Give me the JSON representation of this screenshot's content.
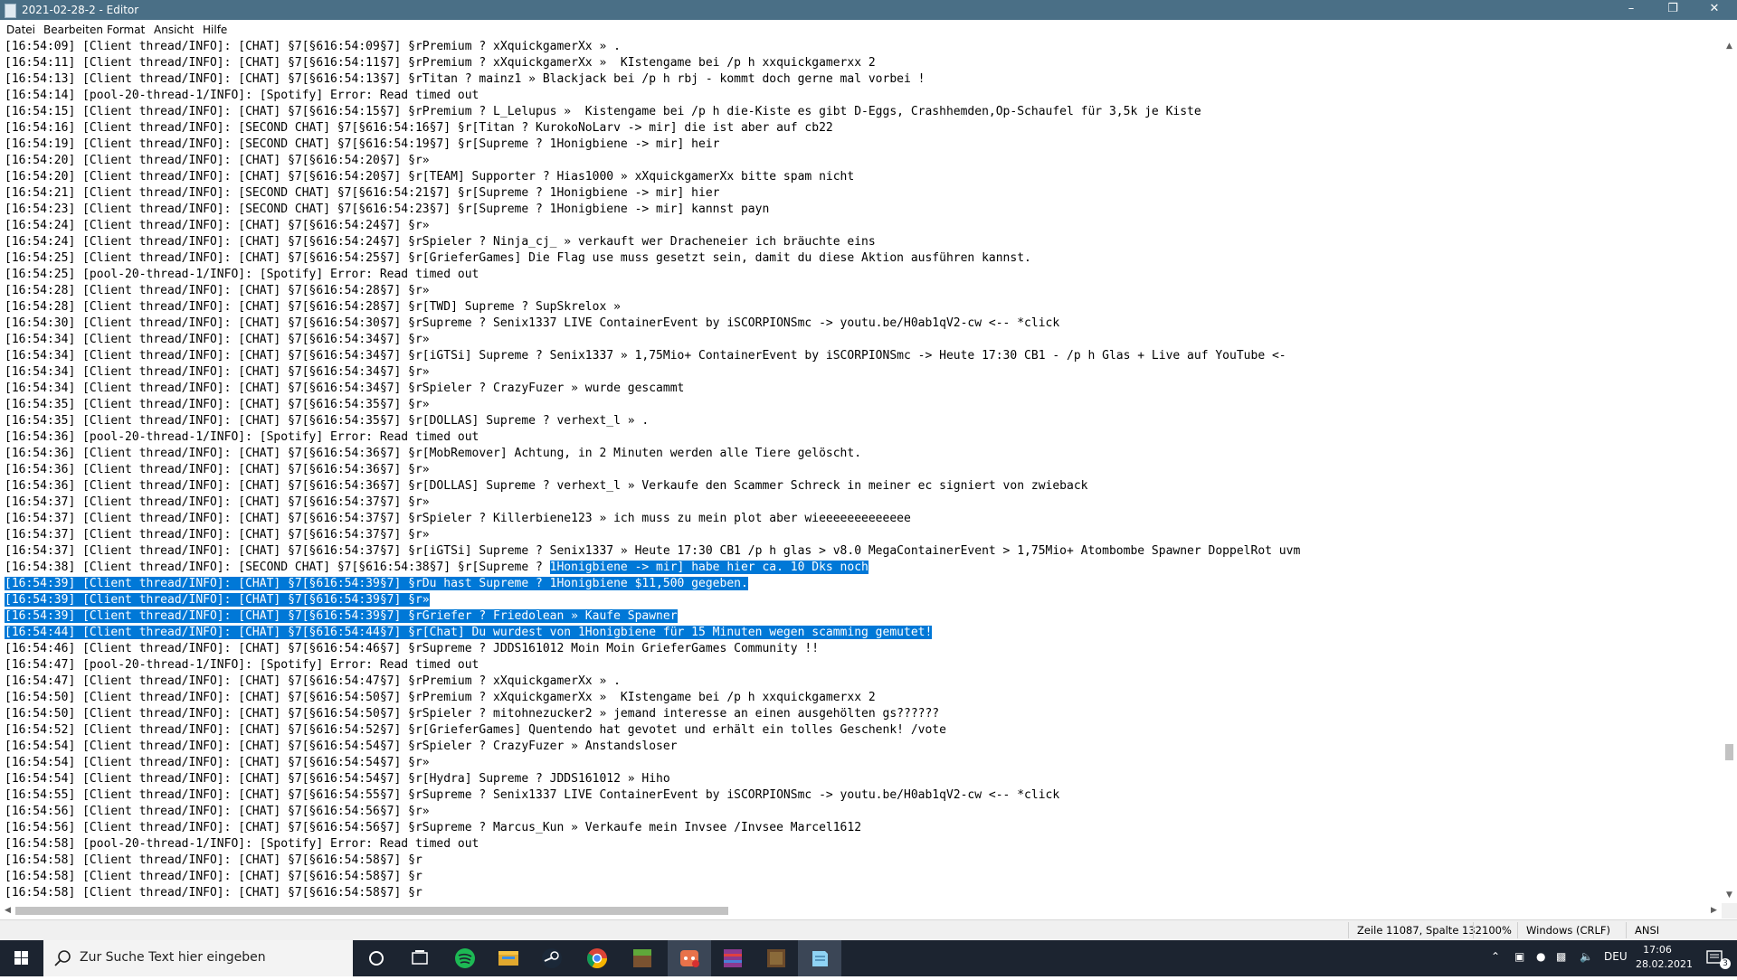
{
  "window": {
    "title": "2021-02-28-2 - Editor"
  },
  "menu": [
    "Datei",
    "Bearbeiten",
    "Format",
    "Ansicht",
    "Hilfe"
  ],
  "lines": [
    [
      "[16:54:09] [Client thread/INFO]: [CHAT] §7[§616:54:09§7] §rPremium ? xXquickgamerXx » .",
      ""
    ],
    [
      "[16:54:11] [Client thread/INFO]: [CHAT] §7[§616:54:11§7] §rPremium ? xXquickgamerXx »  KIstengame bei /p h xxquickgamerxx 2",
      ""
    ],
    [
      "[16:54:13] [Client thread/INFO]: [CHAT] §7[§616:54:13§7] §rTitan ? mainz1 » Blackjack bei /p h rbj - kommt doch gerne mal vorbei !",
      ""
    ],
    [
      "[16:54:14] [pool-20-thread-1/INFO]: [Spotify] Error: Read timed out",
      ""
    ],
    [
      "[16:54:15] [Client thread/INFO]: [CHAT] §7[§616:54:15§7] §rPremium ? L_Lelupus »  Kistengame bei /p h die-Kiste es gibt D-Eggs, Crashhemden,Op-Schaufel für 3,5k je Kiste",
      ""
    ],
    [
      "[16:54:16] [Client thread/INFO]: [SECOND CHAT] §7[§616:54:16§7] §r[Titan ? KurokoNoLarv -> mir] die ist aber auf cb22",
      ""
    ],
    [
      "[16:54:19] [Client thread/INFO]: [SECOND CHAT] §7[§616:54:19§7] §r[Supreme ? 1Honigbiene -> mir] heir",
      ""
    ],
    [
      "[16:54:20] [Client thread/INFO]: [CHAT] §7[§616:54:20§7] §r»",
      ""
    ],
    [
      "[16:54:20] [Client thread/INFO]: [CHAT] §7[§616:54:20§7] §r[TEAM] Supporter ? Hias1000 » xXquickgamerXx bitte spam nicht",
      ""
    ],
    [
      "[16:54:21] [Client thread/INFO]: [SECOND CHAT] §7[§616:54:21§7] §r[Supreme ? 1Honigbiene -> mir] hier",
      ""
    ],
    [
      "[16:54:23] [Client thread/INFO]: [SECOND CHAT] §7[§616:54:23§7] §r[Supreme ? 1Honigbiene -> mir] kannst payn",
      ""
    ],
    [
      "[16:54:24] [Client thread/INFO]: [CHAT] §7[§616:54:24§7] §r»",
      ""
    ],
    [
      "[16:54:24] [Client thread/INFO]: [CHAT] §7[§616:54:24§7] §rSpieler ? Ninja_cj_ » verkauft wer Dracheneier ich bräuchte eins",
      ""
    ],
    [
      "[16:54:25] [Client thread/INFO]: [CHAT] §7[§616:54:25§7] §r[GrieferGames] Die Flag use muss gesetzt sein, damit du diese Aktion ausführen kannst.",
      ""
    ],
    [
      "[16:54:25] [pool-20-thread-1/INFO]: [Spotify] Error: Read timed out",
      ""
    ],
    [
      "[16:54:28] [Client thread/INFO]: [CHAT] §7[§616:54:28§7] §r»",
      ""
    ],
    [
      "[16:54:28] [Client thread/INFO]: [CHAT] §7[§616:54:28§7] §r[TWD] Supreme ? SupSkrelox »",
      ""
    ],
    [
      "[16:54:30] [Client thread/INFO]: [CHAT] §7[§616:54:30§7] §rSupreme ? Senix1337 LIVE ContainerEvent by iSCORPIONSmc -> youtu.be/H0ab1qV2-cw <-- *click",
      ""
    ],
    [
      "[16:54:34] [Client thread/INFO]: [CHAT] §7[§616:54:34§7] §r»",
      ""
    ],
    [
      "[16:54:34] [Client thread/INFO]: [CHAT] §7[§616:54:34§7] §r[iGTSi] Supreme ? Senix1337 » 1,75Mio+ ContainerEvent by iSCORPIONSmc -> Heute 17:30 CB1 - /p h Glas + Live auf YouTube <-",
      ""
    ],
    [
      "[16:54:34] [Client thread/INFO]: [CHAT] §7[§616:54:34§7] §r»",
      ""
    ],
    [
      "[16:54:34] [Client thread/INFO]: [CHAT] §7[§616:54:34§7] §rSpieler ? CrazyFuzer » wurde gescammt",
      ""
    ],
    [
      "[16:54:35] [Client thread/INFO]: [CHAT] §7[§616:54:35§7] §r»",
      ""
    ],
    [
      "[16:54:35] [Client thread/INFO]: [CHAT] §7[§616:54:35§7] §r[DOLLAS] Supreme ? verhext_l » .",
      ""
    ],
    [
      "[16:54:36] [pool-20-thread-1/INFO]: [Spotify] Error: Read timed out",
      ""
    ],
    [
      "[16:54:36] [Client thread/INFO]: [CHAT] §7[§616:54:36§7] §r[MobRemover] Achtung, in 2 Minuten werden alle Tiere gelöscht.",
      ""
    ],
    [
      "[16:54:36] [Client thread/INFO]: [CHAT] §7[§616:54:36§7] §r»",
      ""
    ],
    [
      "[16:54:36] [Client thread/INFO]: [CHAT] §7[§616:54:36§7] §r[DOLLAS] Supreme ? verhext_l » Verkaufe den Scammer Schreck in meiner ec signiert von zwieback",
      ""
    ],
    [
      "[16:54:37] [Client thread/INFO]: [CHAT] §7[§616:54:37§7] §r»",
      ""
    ],
    [
      "[16:54:37] [Client thread/INFO]: [CHAT] §7[§616:54:37§7] §rSpieler ? Killerbiene123 » ich muss zu mein plot aber wieeeeeeeeeeeee",
      ""
    ],
    [
      "[16:54:37] [Client thread/INFO]: [CHAT] §7[§616:54:37§7] §r»",
      ""
    ],
    [
      "[16:54:37] [Client thread/INFO]: [CHAT] §7[§616:54:37§7] §r[iGTSi] Supreme ? Senix1337 » Heute 17:30 CB1 /p h glas > v8.0 MegaContainerEvent > 1,75Mio+ Atombombe Spawner DoppelRot uvm",
      ""
    ],
    [
      "[16:54:38] [Client thread/INFO]: [SECOND CHAT] §7[§616:54:38§7] §r[Supreme ? ",
      "1Honigbiene -> mir] habe hier ca. 10 Dks noch"
    ],
    [
      "",
      "[16:54:39] [Client thread/INFO]: [CHAT] §7[§616:54:39§7] §rDu hast Supreme ? 1Honigbiene $11,500 gegeben."
    ],
    [
      "",
      "[16:54:39] [Client thread/INFO]: [CHAT] §7[§616:54:39§7] §r»"
    ],
    [
      "",
      "[16:54:39] [Client thread/INFO]: [CHAT] §7[§616:54:39§7] §rGriefer ? Friedolean » Kaufe Spawner"
    ],
    [
      "",
      "[16:54:44] [Client thread/INFO]: [CHAT] §7[§616:54:44§7] §r[Chat] Du wurdest von 1Honigbiene für 15 Minuten wegen scamming gemutet!"
    ],
    [
      "[16:54:46] [Client thread/INFO]: [CHAT] §7[§616:54:46§7] §rSupreme ? JDDS161012 Moin Moin GrieferGames Community !!",
      ""
    ],
    [
      "[16:54:47] [pool-20-thread-1/INFO]: [Spotify] Error: Read timed out",
      ""
    ],
    [
      "[16:54:47] [Client thread/INFO]: [CHAT] §7[§616:54:47§7] §rPremium ? xXquickgamerXx » .",
      ""
    ],
    [
      "[16:54:50] [Client thread/INFO]: [CHAT] §7[§616:54:50§7] §rPremium ? xXquickgamerXx »  KIstengame bei /p h xxquickgamerxx 2",
      ""
    ],
    [
      "[16:54:50] [Client thread/INFO]: [CHAT] §7[§616:54:50§7] §rSpieler ? mitohnezucker2 » jemand interesse an einen ausgehölten gs??????",
      ""
    ],
    [
      "[16:54:52] [Client thread/INFO]: [CHAT] §7[§616:54:52§7] §r[GrieferGames] Quentendo hat gevotet und erhält ein tolles Geschenk! /vote",
      ""
    ],
    [
      "[16:54:54] [Client thread/INFO]: [CHAT] §7[§616:54:54§7] §rSpieler ? CrazyFuzer » Anstandsloser",
      ""
    ],
    [
      "[16:54:54] [Client thread/INFO]: [CHAT] §7[§616:54:54§7] §r»",
      ""
    ],
    [
      "[16:54:54] [Client thread/INFO]: [CHAT] §7[§616:54:54§7] §r[Hydra] Supreme ? JDDS161012 » Hiho",
      ""
    ],
    [
      "[16:54:55] [Client thread/INFO]: [CHAT] §7[§616:54:55§7] §rSupreme ? Senix1337 LIVE ContainerEvent by iSCORPIONSmc -> youtu.be/H0ab1qV2-cw <-- *click",
      ""
    ],
    [
      "[16:54:56] [Client thread/INFO]: [CHAT] §7[§616:54:56§7] §r»",
      ""
    ],
    [
      "[16:54:56] [Client thread/INFO]: [CHAT] §7[§616:54:56§7] §rSupreme ? Marcus_Kun » Verkaufe mein Invsee /Invsee Marcel1612",
      ""
    ],
    [
      "[16:54:58] [pool-20-thread-1/INFO]: [Spotify] Error: Read timed out",
      ""
    ],
    [
      "[16:54:58] [Client thread/INFO]: [CHAT] §7[§616:54:58§7] §r",
      ""
    ],
    [
      "[16:54:58] [Client thread/INFO]: [CHAT] §7[§616:54:58§7] §r",
      ""
    ],
    [
      "[16:54:58] [Client thread/INFO]: [CHAT] §7[§616:54:58§7] §r",
      ""
    ]
  ],
  "status": {
    "position": "Zeile 11087, Spalte 132",
    "zoom": "100%",
    "line_ending": "Windows (CRLF)",
    "encoding": "ANSI"
  },
  "taskbar": {
    "search_placeholder": "Zur Suche Text hier eingeben",
    "apps": [
      "cortana-icon",
      "task-view-icon",
      "spotify-icon",
      "file-explorer-icon",
      "steam-icon",
      "chrome-icon",
      "minecraft-icon",
      "discord-icon",
      "winrar-icon",
      "minecraft-launcher-icon",
      "notepad-icon"
    ],
    "language": "DEU",
    "time": "17:06",
    "date": "28.02.2021",
    "notification_count": "3"
  },
  "colors": {
    "titlebar": "#4a6f86",
    "selection": "#0078d7",
    "taskbar": "#1c2430"
  }
}
